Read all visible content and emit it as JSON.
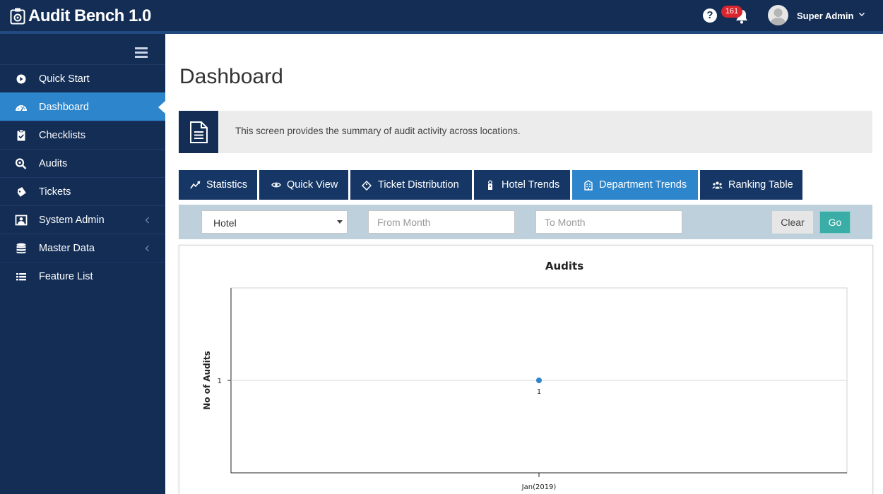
{
  "app": {
    "title": "Audit Bench 1.0"
  },
  "header": {
    "notification_count": "161",
    "user_name": "Super Admin",
    "help_glyph": "?",
    "icons": [
      "help-icon",
      "bell-icon",
      "avatar",
      "chevron-down-icon"
    ]
  },
  "sidebar": {
    "items": [
      {
        "label": "Quick Start",
        "icon": "play-circle-icon",
        "active": false,
        "submenu": false
      },
      {
        "label": "Dashboard",
        "icon": "dashboard-gauge-icon",
        "active": true,
        "submenu": false
      },
      {
        "label": "Checklists",
        "icon": "clipboard-check-icon",
        "active": false,
        "submenu": false
      },
      {
        "label": "Audits",
        "icon": "search-audit-icon",
        "active": false,
        "submenu": false
      },
      {
        "label": "Tickets",
        "icon": "ticket-icon",
        "active": false,
        "submenu": false
      },
      {
        "label": "System Admin",
        "icon": "admin-portrait-icon",
        "active": false,
        "submenu": true
      },
      {
        "label": "Master Data",
        "icon": "database-icon",
        "active": false,
        "submenu": true
      },
      {
        "label": "Feature List",
        "icon": "list-icon",
        "active": false,
        "submenu": false
      }
    ]
  },
  "page": {
    "title": "Dashboard",
    "info_text": "This screen provides the summary of audit activity across locations."
  },
  "tabs": [
    {
      "label": "Statistics",
      "icon": "line-chart-icon",
      "active": false
    },
    {
      "label": "Quick View",
      "icon": "eye-icon",
      "active": false
    },
    {
      "label": "Ticket Distribution",
      "icon": "ticket-tag-icon",
      "active": false
    },
    {
      "label": "Hotel Trends",
      "icon": "door-hanger-icon",
      "active": false
    },
    {
      "label": "Department Trends",
      "icon": "building-icon",
      "active": true
    },
    {
      "label": "Ranking Table",
      "icon": "users-group-icon",
      "active": false
    }
  ],
  "filters": {
    "location_selected": "Hotel",
    "from_month_placeholder": "From Month",
    "to_month_placeholder": "To Month",
    "clear_label": "Clear",
    "go_label": "Go"
  },
  "colors": {
    "navy": "#132d55",
    "accent_blue": "#2d85cc",
    "teal": "#3aaea6",
    "badge_red": "#d9252e",
    "filter_bg": "#bed0dc"
  },
  "chart_data": {
    "type": "scatter",
    "title": "Audits",
    "xlabel": "",
    "ylabel": "No of Audits",
    "categories": [
      "Jan(2019)"
    ],
    "series": [
      {
        "values": [
          1
        ],
        "color": "#2d85cc"
      }
    ],
    "y_ticks": [
      1
    ],
    "data_labels": [
      "1"
    ],
    "grid": true
  }
}
